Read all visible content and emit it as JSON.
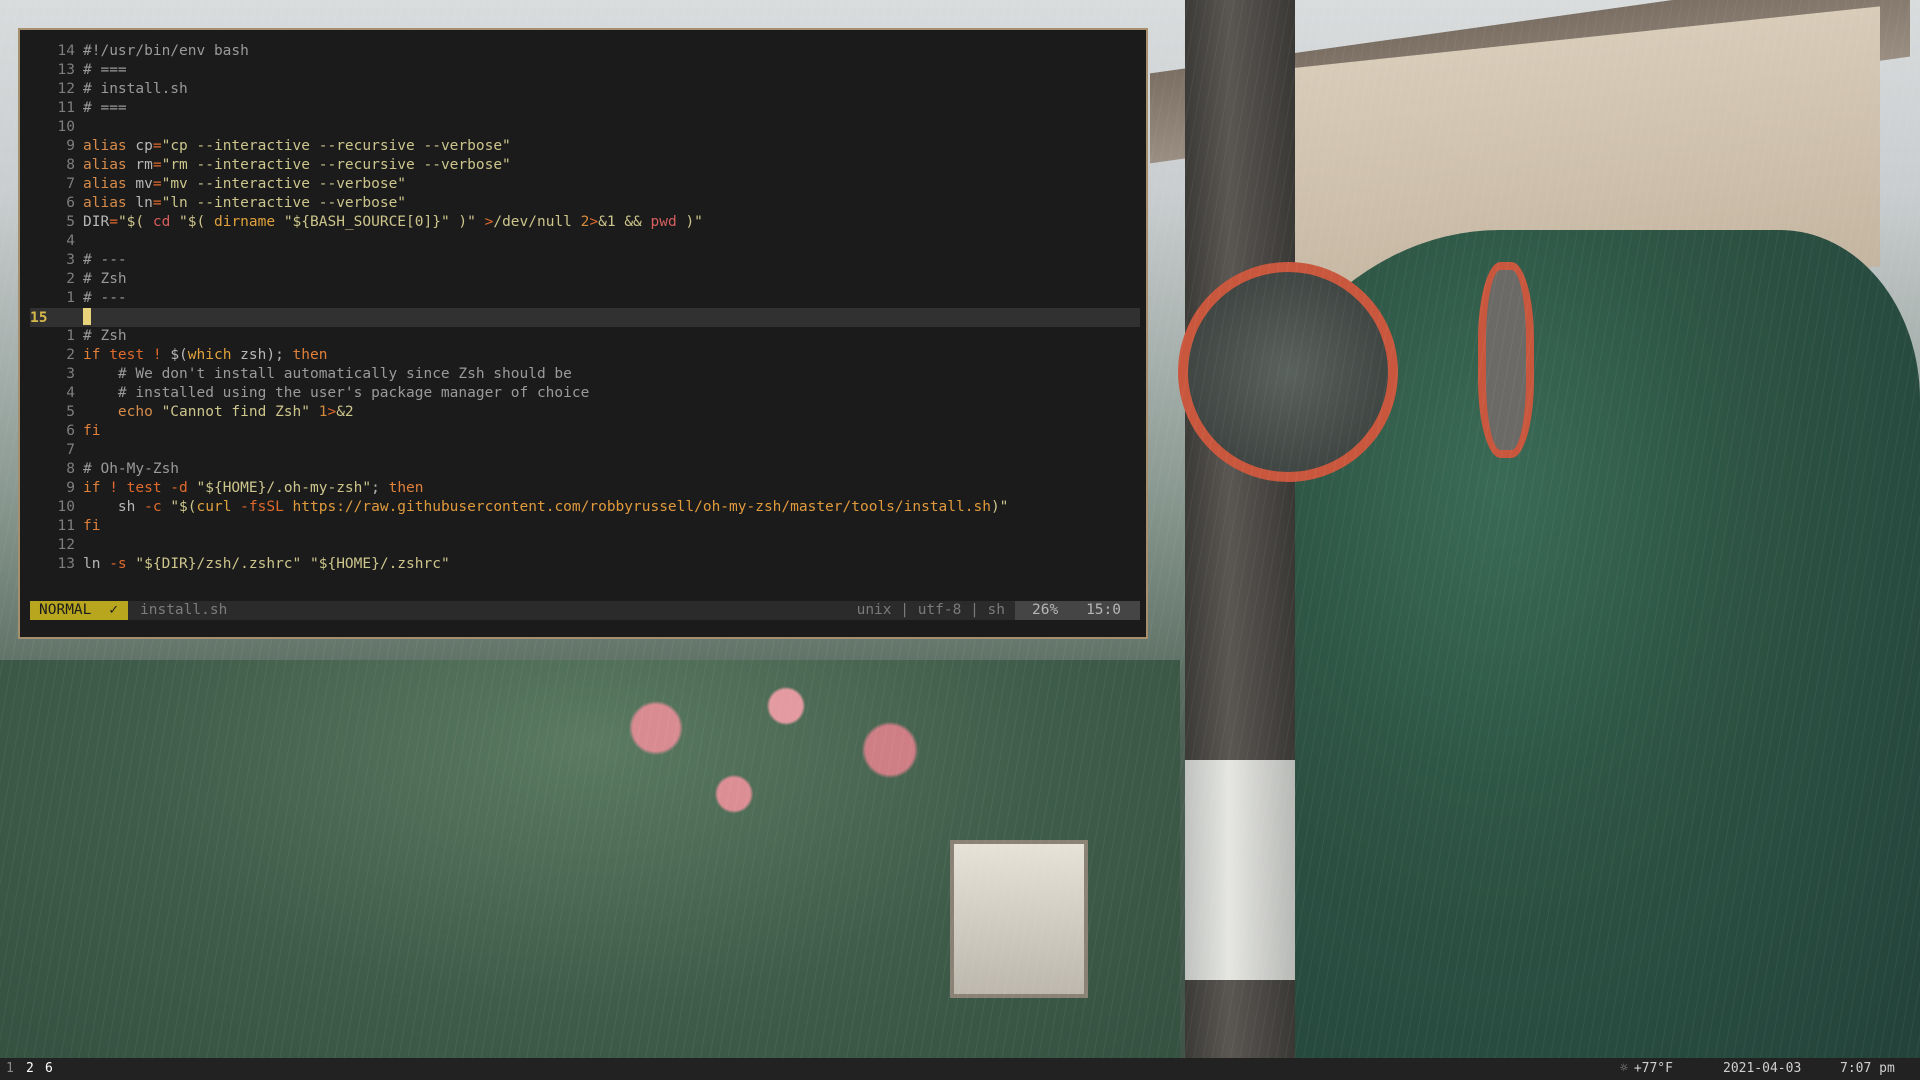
{
  "editor": {
    "lines": [
      {
        "num": "14",
        "segs": [
          [
            "cmt",
            "#!/usr/bin/env bash"
          ]
        ]
      },
      {
        "num": "13",
        "segs": [
          [
            "cmt",
            "# ==="
          ]
        ]
      },
      {
        "num": "12",
        "segs": [
          [
            "cmt",
            "# install.sh"
          ]
        ]
      },
      {
        "num": "11",
        "segs": [
          [
            "cmt",
            "# ==="
          ]
        ]
      },
      {
        "num": "10",
        "segs": []
      },
      {
        "num": "9",
        "segs": [
          [
            "al",
            "alias "
          ],
          [
            "var",
            "cp"
          ],
          [
            "op",
            "="
          ],
          [
            "str",
            "\"cp --interactive --recursive --verbose\""
          ]
        ]
      },
      {
        "num": "8",
        "segs": [
          [
            "al",
            "alias "
          ],
          [
            "var",
            "rm"
          ],
          [
            "op",
            "="
          ],
          [
            "str",
            "\"rm --interactive --recursive --verbose\""
          ]
        ]
      },
      {
        "num": "7",
        "segs": [
          [
            "al",
            "alias "
          ],
          [
            "var",
            "mv"
          ],
          [
            "op",
            "="
          ],
          [
            "str",
            "\"mv --interactive --verbose\""
          ]
        ]
      },
      {
        "num": "6",
        "segs": [
          [
            "al",
            "alias "
          ],
          [
            "var",
            "ln"
          ],
          [
            "op",
            "="
          ],
          [
            "str",
            "\"ln --interactive --verbose\""
          ]
        ]
      },
      {
        "num": "5",
        "segs": [
          [
            "var",
            "DIR"
          ],
          [
            "op",
            "="
          ],
          [
            "str",
            "\"$( "
          ],
          [
            "cmd",
            "cd"
          ],
          [
            "str",
            " \"$( "
          ],
          [
            "fn",
            "dirname"
          ],
          [
            "str",
            " \"${BASH_SOURCE[0]}\" )\" "
          ],
          [
            "op",
            ">"
          ],
          [
            "str",
            "/dev/null "
          ],
          [
            "num",
            "2"
          ],
          [
            "op",
            ">"
          ],
          [
            "str",
            "&1 && "
          ],
          [
            "cmd",
            "pwd"
          ],
          [
            "str",
            " )\""
          ]
        ]
      },
      {
        "num": "4",
        "segs": []
      },
      {
        "num": "3",
        "segs": [
          [
            "cmt",
            "# ---"
          ]
        ]
      },
      {
        "num": "2",
        "segs": [
          [
            "cmt",
            "# Zsh"
          ]
        ]
      },
      {
        "num": "1",
        "segs": [
          [
            "cmt",
            "# ---"
          ]
        ]
      },
      {
        "num": "15",
        "segs": [],
        "current": true
      },
      {
        "num": "1",
        "segs": [
          [
            "cmt",
            "# Zsh"
          ]
        ]
      },
      {
        "num": "2",
        "segs": [
          [
            "kw",
            "if "
          ],
          [
            "op",
            "test ! "
          ],
          [
            "var",
            "$("
          ],
          [
            "fn",
            "which"
          ],
          [
            "var",
            " zsh); "
          ],
          [
            "kw",
            "then"
          ]
        ]
      },
      {
        "num": "3",
        "segs": [
          [
            "cmt",
            "    # We don't install automatically since Zsh should be"
          ]
        ]
      },
      {
        "num": "4",
        "segs": [
          [
            "cmt",
            "    # installed using the user's package manager of choice"
          ]
        ]
      },
      {
        "num": "5",
        "segs": [
          [
            "var",
            "    "
          ],
          [
            "al",
            "echo "
          ],
          [
            "str",
            "\"Cannot find Zsh\" "
          ],
          [
            "num",
            "1"
          ],
          [
            "op",
            ">"
          ],
          [
            "str",
            "&2"
          ]
        ]
      },
      {
        "num": "6",
        "segs": [
          [
            "kw",
            "fi"
          ]
        ]
      },
      {
        "num": "7",
        "segs": []
      },
      {
        "num": "8",
        "segs": [
          [
            "cmt",
            "# Oh-My-Zsh"
          ]
        ]
      },
      {
        "num": "9",
        "segs": [
          [
            "kw",
            "if "
          ],
          [
            "op",
            "! test -d "
          ],
          [
            "str",
            "\"${HOME}/.oh-my-zsh\""
          ],
          [
            "var",
            "; "
          ],
          [
            "kw",
            "then"
          ]
        ]
      },
      {
        "num": "10",
        "segs": [
          [
            "var",
            "    sh "
          ],
          [
            "op",
            "-c "
          ],
          [
            "str",
            "\"$("
          ],
          [
            "fn",
            "curl"
          ],
          [
            "op",
            " -fsSL "
          ],
          [
            "url",
            "https://raw.githubusercontent.com/robbyrussell/oh-my-zsh/master/tools/install.sh"
          ],
          [
            "str",
            ")\""
          ]
        ]
      },
      {
        "num": "11",
        "segs": [
          [
            "kw",
            "fi"
          ]
        ]
      },
      {
        "num": "12",
        "segs": []
      },
      {
        "num": "13",
        "segs": [
          [
            "var",
            "ln "
          ],
          [
            "op",
            "-s "
          ],
          [
            "str",
            "\"${DIR}/zsh/.zshrc\" \"${HOME}/.zshrc\""
          ]
        ]
      }
    ]
  },
  "statusline": {
    "mode": "NORMAL",
    "check": "✓",
    "filename": "install.sh",
    "fileinfo": "unix | utf-8 | sh",
    "percent": "26%",
    "position": "15:0"
  },
  "bar": {
    "workspaces": [
      "1",
      "2",
      "6"
    ],
    "weather_icon": "sun-icon",
    "weather": "+77°F",
    "date": "2021-04-03",
    "time": "7:07 pm"
  }
}
